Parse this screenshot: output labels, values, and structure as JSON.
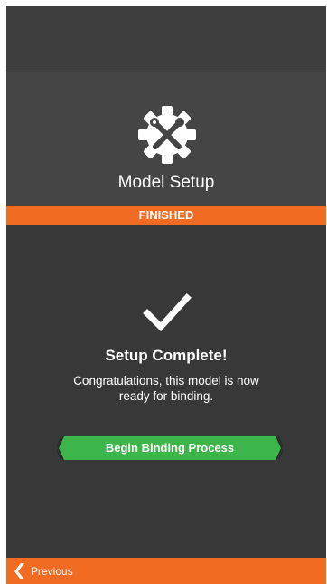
{
  "header": {
    "title": "Model Setup",
    "icon": "gear-wrench-icon"
  },
  "status": {
    "label": "FINISHED",
    "color": "#f26b22"
  },
  "content": {
    "icon": "checkmark-icon",
    "title": "Setup Complete!",
    "message": "Congratulations, this model is now ready for binding.",
    "action_label": "Begin Binding Process",
    "action_color": "#3cb54a"
  },
  "footer": {
    "previous_label": "Previous",
    "previous_icon": "chevron-left-icon",
    "color": "#f26b22"
  }
}
